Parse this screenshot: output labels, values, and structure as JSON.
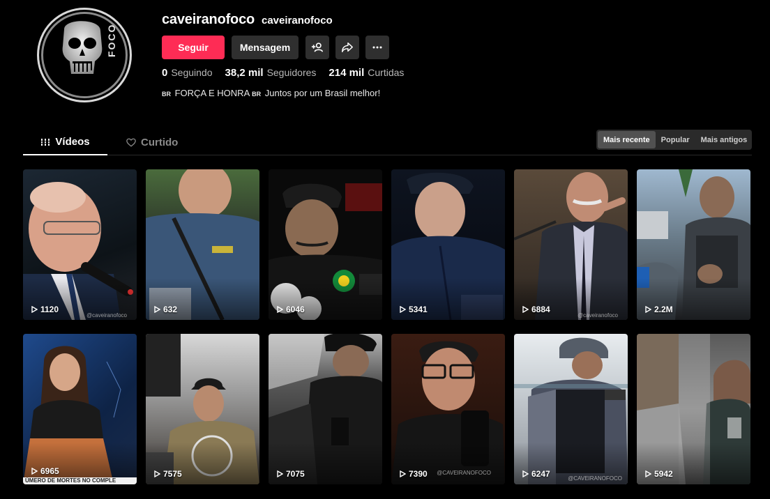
{
  "profile": {
    "username": "caveiranofoco",
    "handle": "caveiranofoco",
    "avatar_text": "FOCO",
    "follow_label": "Seguir",
    "message_label": "Mensagem",
    "stats": [
      {
        "num": "0",
        "label": "Seguindo"
      },
      {
        "num": "38,2 mil",
        "label": "Seguidores"
      },
      {
        "num": "214 mil",
        "label": "Curtidas"
      }
    ],
    "bio": {
      "cc1": "BR",
      "part1": " FORÇA E HONRA ",
      "cc2": "BR",
      "part2": " Juntos por um Brasil melhor!"
    }
  },
  "tabs": {
    "videos": "Vídeos",
    "liked": "Curtido"
  },
  "sort": [
    "Mais recente",
    "Popular",
    "Mais antigos"
  ],
  "videos": [
    {
      "views": "1120",
      "watermark": "@caveiranofoco"
    },
    {
      "views": "632",
      "watermark": ""
    },
    {
      "views": "6046",
      "watermark": ""
    },
    {
      "views": "5341",
      "watermark": ""
    },
    {
      "views": "6884",
      "watermark": "@caveiranofoco"
    },
    {
      "views": "2.2M",
      "watermark": ""
    },
    {
      "views": "6965",
      "watermark": "",
      "caption": "ÚMERO DE MORTES NO COMPLE"
    },
    {
      "views": "7575",
      "watermark": ""
    },
    {
      "views": "7075",
      "watermark": ""
    },
    {
      "views": "7390",
      "watermark": "@CAVEIRANOFOCO"
    },
    {
      "views": "6247",
      "watermark": "@CAVEIRANOFOCO"
    },
    {
      "views": "5942",
      "watermark": ""
    }
  ],
  "colors": {
    "accent": "#fe2c55",
    "background": "#000000",
    "button": "#2f2f2f"
  }
}
